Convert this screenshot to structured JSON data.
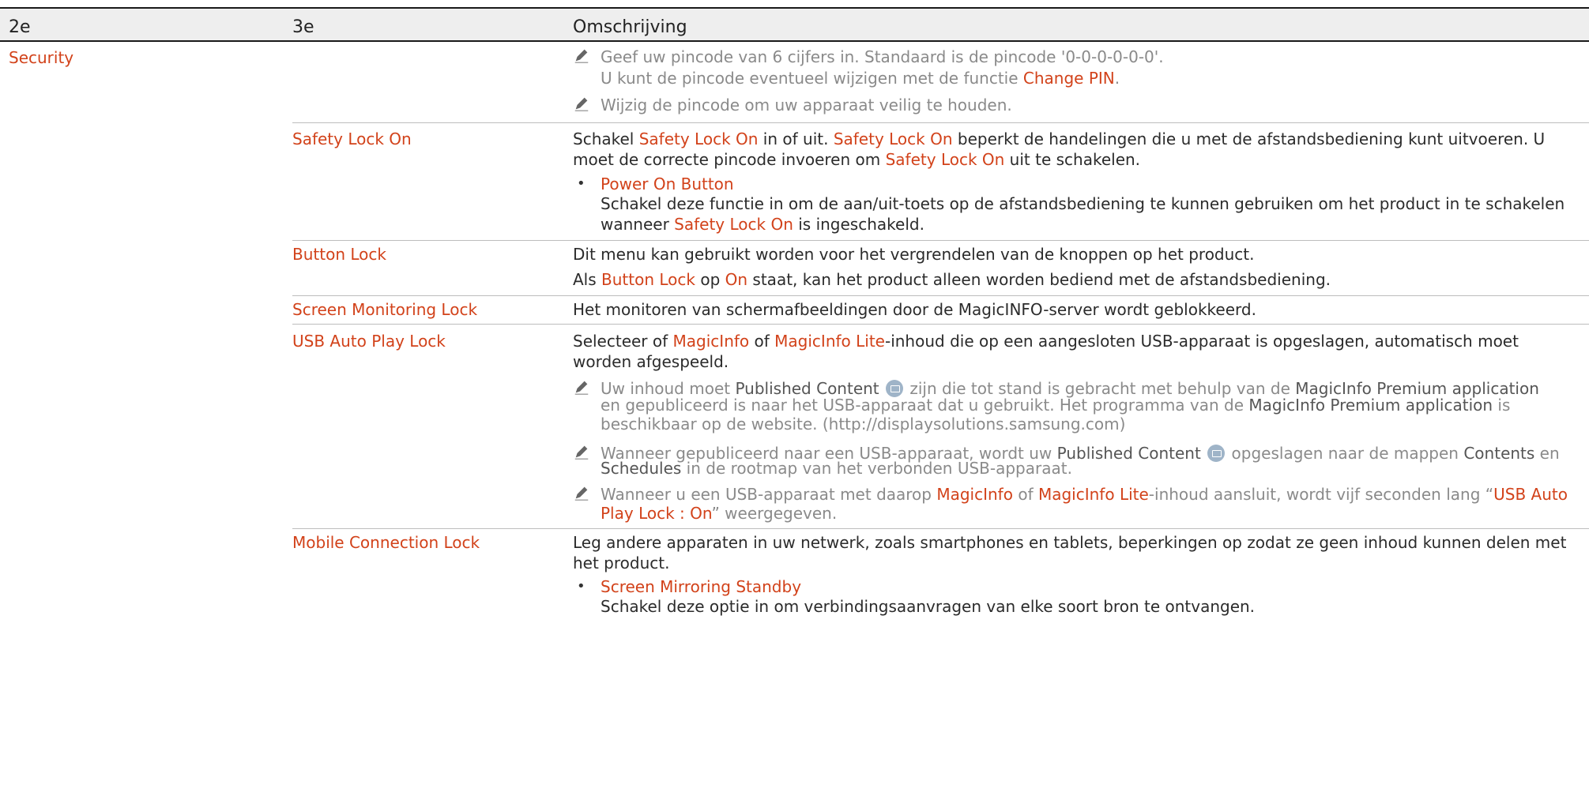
{
  "header": {
    "col1": "2e",
    "col2": "3e",
    "col3": "Omschrijving"
  },
  "section": {
    "label": "Security"
  },
  "intro": {
    "note1_a": "Geef uw pincode van 6 cijfers in. Standaard is de pincode '0-0-0-0-0-0'.",
    "note1_b_pre": "U kunt de pincode eventueel wijzigen met de functie ",
    "note1_b_key": "Change PIN",
    "note1_b_post": ".",
    "note2": "Wijzig de pincode om uw apparaat veilig te houden."
  },
  "rows": {
    "safety": {
      "label": "Safety Lock On",
      "l1_a": "Schakel ",
      "l1_k1": "Safety Lock On",
      "l1_b": " in of uit. ",
      "l1_k2": "Safety Lock On",
      "l1_c": " beperkt de handelingen die u met de afstandsbediening kunt uitvoeren. U",
      "l2_a": "moet de correcte pincode invoeren om ",
      "l2_k": "Safety Lock On",
      "l2_b": " uit te schakelen.",
      "bullet_title": "Power On Button",
      "b1": "Schakel deze functie in om de aan/uit-toets op de afstandsbediening te kunnen gebruiken om het product in te schakelen",
      "b2_a": "wanneer ",
      "b2_k": "Safety Lock On",
      "b2_b": " is ingeschakeld."
    },
    "button": {
      "label": "Button Lock",
      "l1": "Dit menu kan gebruikt worden voor het vergrendelen van de knoppen op het product.",
      "l2_a": "Als ",
      "l2_k1": "Button Lock",
      "l2_b": " op ",
      "l2_k2": "On",
      "l2_c": " staat, kan het product alleen worden bediend met de afstandsbediening."
    },
    "screen": {
      "label": "Screen Monitoring Lock",
      "l1": "Het monitoren van schermafbeeldingen door de MagicINFO-server wordt geblokkeerd."
    },
    "usb": {
      "label": "USB Auto Play Lock",
      "l1_a": "Selecteer of ",
      "l1_k1": "MagicInfo",
      "l1_b": " of ",
      "l1_k2": "MagicInfo Lite",
      "l1_c": "-inhoud die op een aangesloten USB-apparaat is opgeslagen, automatisch moet",
      "l2": "worden afgespeeld.",
      "n1_a": "Uw inhoud moet ",
      "n1_d1": "Published Content",
      "n1_b": " zijn die tot stand is gebracht met behulp van de ",
      "n1_d2": "MagicInfo Premium application",
      "n1_l2_a": "en gepubliceerd is naar het USB-apparaat dat u gebruikt. Het programma van de ",
      "n1_l2_d": "MagicInfo Premium application",
      "n1_l2_b": " is",
      "n1_l3": "beschikbaar op de website. (http://displaysolutions.samsung.com)",
      "n2_a": "Wanneer gepubliceerd naar een USB-apparaat, wordt uw ",
      "n2_d1": "Published Content",
      "n2_b": " opgeslagen naar de mappen ",
      "n2_d2": "Contents",
      "n2_c": " en",
      "n2_l2_d": "Schedules",
      "n2_l2_b": " in de rootmap van het verbonden USB-apparaat.",
      "n3_a": "Wanneer u een USB-apparaat met daarop ",
      "n3_k1": "MagicInfo",
      "n3_b": " of ",
      "n3_k2": "MagicInfo Lite",
      "n3_c": "-inhoud aansluit, wordt vijf seconden lang “",
      "n3_k3": "USB Auto",
      "n3_l2_k": "Play Lock : On",
      "n3_l2_b": "” weergegeven."
    },
    "mobile": {
      "label": "Mobile Connection Lock",
      "l1": "Leg andere apparaten in uw netwerk, zoals smartphones en tablets, beperkingen op zodat ze geen inhoud kunnen delen met",
      "l2": "het product.",
      "bullet_title": "Screen Mirroring Standby",
      "b1": "Schakel deze optie in om verbindingsaanvragen van elke soort bron te ontvangen."
    }
  },
  "colors": {
    "keyword": "#d2421a",
    "note": "#8a8a8a",
    "header_bg": "#eeeeee",
    "rule": "#bdbdbd"
  },
  "icons": {
    "note": "pencil-icon",
    "content": "published-content-icon"
  }
}
